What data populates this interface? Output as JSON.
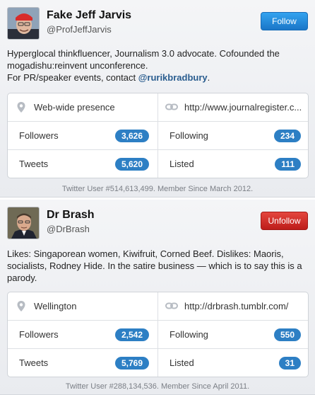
{
  "profiles": [
    {
      "name": "Fake Jeff Jarvis",
      "handle": "@ProfJeffJarvis",
      "button_label": "Follow",
      "button_color": "#1b76c8",
      "bio_line1": "Hyperglocal thinkfluencer, Journalism 3.0 advocate. Cofounded the",
      "bio_line2": "mogadishu:reinvent unconference.",
      "bio_line3_prefix": "For PR/speaker events, contact ",
      "bio_mention": "@rurikbradbury",
      "bio_line3_suffix": ".",
      "location": "Web-wide presence",
      "url": "http://www.journalregister.c...",
      "followers_label": "Followers",
      "followers": "3,626",
      "following_label": "Following",
      "following": "234",
      "tweets_label": "Tweets",
      "tweets": "5,620",
      "listed_label": "Listed",
      "listed": "111",
      "footer": "Twitter User #514,613,499. Member Since March 2012."
    },
    {
      "name": "Dr Brash",
      "handle": "@DrBrash",
      "button_label": "Unfollow",
      "button_color": "#bd1d1a",
      "bio_line1": "Likes: Singaporean women, Kiwifruit, Corned Beef. Dislikes: Maoris,",
      "bio_line2": "socialists, Rodney Hide. In the satire business — which is to say this is a",
      "bio_line3": "parody.",
      "location": "Wellington",
      "url": "http://drbrash.tumblr.com/",
      "followers_label": "Followers",
      "followers": "2,542",
      "following_label": "Following",
      "following": "550",
      "tweets_label": "Tweets",
      "tweets": "5,769",
      "listed_label": "Listed",
      "listed": "31",
      "footer": "Twitter User #288,134,536. Member Since April 2011."
    }
  ],
  "icons": {
    "location": "location-pin-icon",
    "url": "link-icon"
  },
  "colors": {
    "badge": "#2d7fc4",
    "mention": "#2a5d8f"
  }
}
